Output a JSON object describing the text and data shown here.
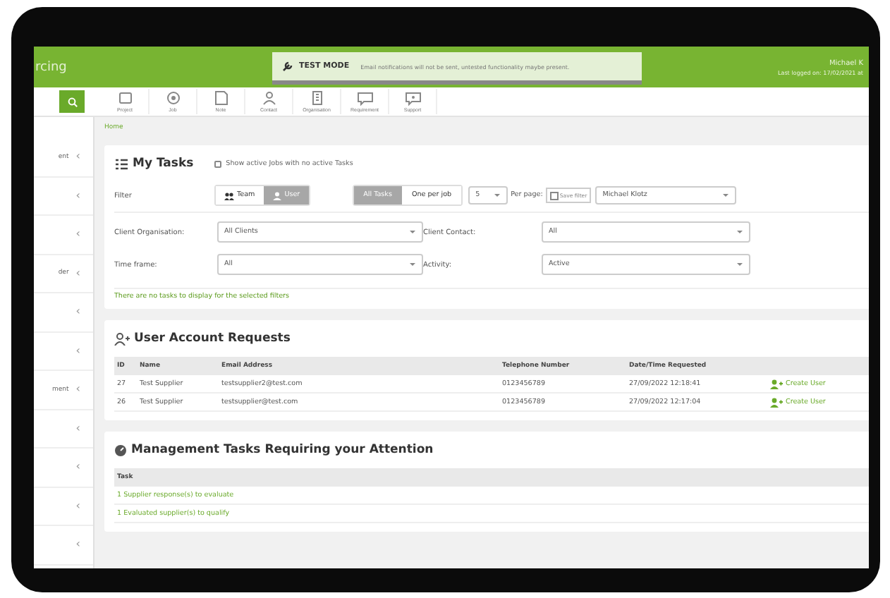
{
  "header": {
    "logo": "rcing",
    "user": "Michael K",
    "last_logged": "Last logged on: 17/02/2021 at"
  },
  "banner": {
    "label": "TEST MODE",
    "message": "Email notifications will not be sent, untested functionality maybe present."
  },
  "toolbar": [
    {
      "label": "Project"
    },
    {
      "label": "Job"
    },
    {
      "label": "Note"
    },
    {
      "label": "Contact"
    },
    {
      "label": "Organisation"
    },
    {
      "label": "Requirement"
    },
    {
      "label": "Support"
    }
  ],
  "breadcrumb": "Home",
  "sidebar": {
    "items": [
      {
        "label": "ent",
        "chevron": "‹"
      },
      {
        "chevron": "‹"
      },
      {
        "chevron": "‹"
      },
      {
        "label": "der",
        "chevron": "‹"
      },
      {
        "chevron": "‹"
      },
      {
        "chevron": "‹"
      },
      {
        "label": "ment",
        "chevron": "‹"
      },
      {
        "chevron": "‹"
      },
      {
        "chevron": "‹"
      },
      {
        "chevron": "‹"
      },
      {
        "chevron": "‹"
      }
    ]
  },
  "my_tasks": {
    "title": "My Tasks",
    "checkbox": {
      "label": "Show active Jobs with no active Tasks",
      "checked": false
    },
    "filter_label": "Filter",
    "scope_toggle": [
      {
        "label": "Team",
        "selected": false
      },
      {
        "label": "User",
        "selected": true
      }
    ],
    "view_toggle": [
      {
        "label": "All Tasks",
        "selected": true
      },
      {
        "label": "One per job",
        "selected": false
      }
    ],
    "per_page": {
      "value": "5",
      "label": "Per page:"
    },
    "save_filter": "Save filter",
    "assignee": "Michael Klotz",
    "fields": [
      {
        "label": "Client Organisation:",
        "value": "All Clients"
      },
      {
        "label": "Client Contact:",
        "value": "All"
      },
      {
        "label": "Time frame:",
        "value": "All"
      },
      {
        "label": "Activity:",
        "value": "Active"
      }
    ],
    "empty_message": "There are no tasks to display for the selected filters"
  },
  "account_requests": {
    "title": "User Account Requests",
    "columns": [
      "ID",
      "Name",
      "Email Address",
      "Telephone Number",
      "Date/Time Requested"
    ],
    "rows": [
      {
        "id": "27",
        "name": "Test Supplier",
        "email": "testsupplier2@test.com",
        "phone": "0123456789",
        "requested": "27/09/2022 12:18:41",
        "action": "Create User"
      },
      {
        "id": "26",
        "name": "Test Supplier",
        "email": "testsupplier@test.com",
        "phone": "0123456789",
        "requested": "27/09/2022 12:17:04",
        "action": "Create User"
      }
    ]
  },
  "management": {
    "title": "Management Tasks Requiring your Attention",
    "columns": [
      "Task"
    ],
    "rows": [
      "1 Supplier response(s) to evaluate",
      "1 Evaluated supplier(s) to qualify"
    ]
  }
}
